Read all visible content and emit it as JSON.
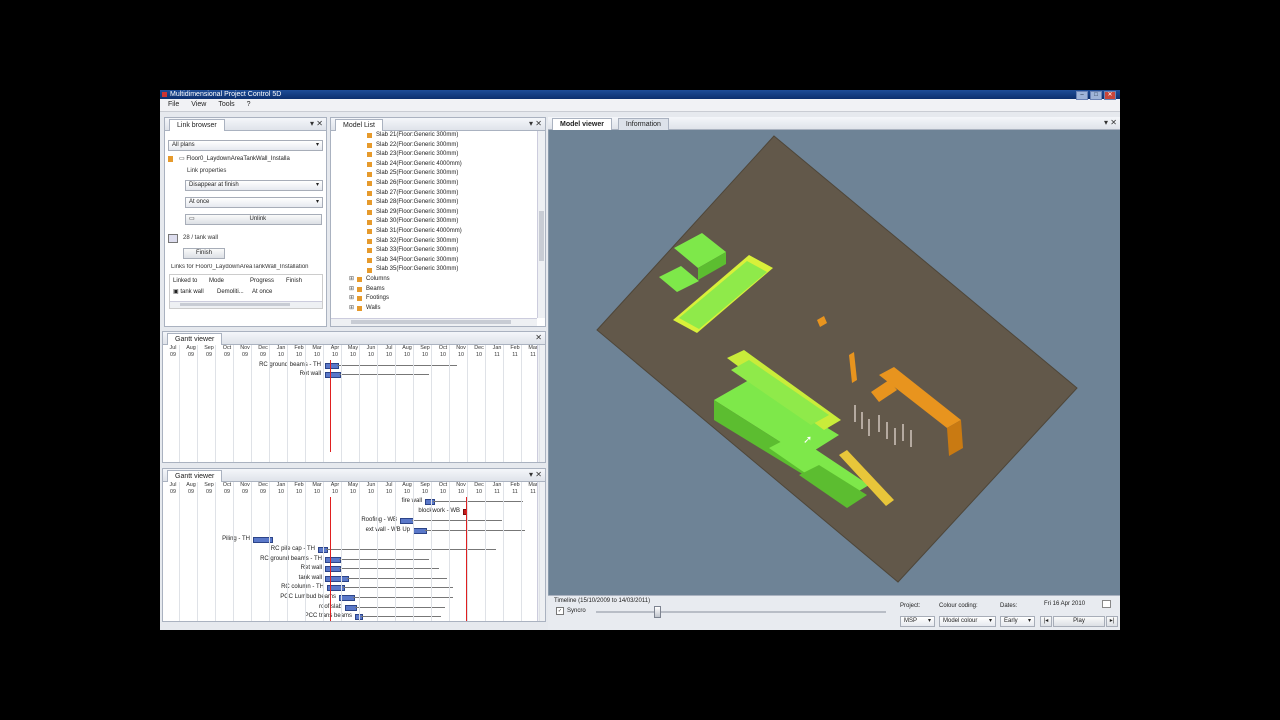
{
  "window": {
    "title": "Multidimensional Project Control 5D"
  },
  "menu": [
    "File",
    "View",
    "Tools",
    "?"
  ],
  "link_browser": {
    "tab": "Link browser",
    "plans": "All plans",
    "item": "Floor0_LaydownAreaTankWall_Installa",
    "link_properties": "Link properties",
    "mode": "Disappear at finish",
    "timing": "At once",
    "unlink": "Unlink",
    "task": "28 / tank wall",
    "finish": "Finish",
    "links_for": "Links for Floor0_LaydownAreaTankWall_Installation",
    "headers": [
      "Linked to",
      "Mode",
      "Progress",
      "Finish"
    ],
    "row": [
      "tank wall",
      "Demoliti...",
      "At once"
    ]
  },
  "model_list": {
    "tab": "Model List",
    "slabs": [
      "Slab 21(Floor:Generic 300mm)",
      "Slab 22(Floor:Generic 300mm)",
      "Slab 23(Floor:Generic 300mm)",
      "Slab 24(Floor:Generic 4000mm)",
      "Slab 25(Floor:Generic 300mm)",
      "Slab 26(Floor:Generic 300mm)",
      "Slab 27(Floor:Generic 300mm)",
      "Slab 28(Floor:Generic 300mm)",
      "Slab 29(Floor:Generic 300mm)",
      "Slab 30(Floor:Generic 300mm)",
      "Slab 31(Floor:Generic 4000mm)",
      "Slab 32(Floor:Generic 300mm)",
      "Slab 33(Floor:Generic 300mm)",
      "Slab 34(Floor:Generic 300mm)",
      "Slab 35(Floor:Generic 300mm)"
    ],
    "groups": [
      "Columns",
      "Beams",
      "Footings",
      "Walls"
    ]
  },
  "gantt1": {
    "tab": "Gantt viewer",
    "months": [
      "Jul",
      "Aug",
      "Sep",
      "Oct",
      "Nov",
      "Dec",
      "Jan",
      "Feb",
      "Mar",
      "Apr",
      "May",
      "Jun",
      "Jul",
      "Aug",
      "Sep",
      "Oct",
      "Nov",
      "Dec",
      "Jan",
      "Feb",
      "Mar"
    ],
    "years": [
      "09",
      "09",
      "09",
      "09",
      "09",
      "09",
      "10",
      "10",
      "10",
      "10",
      "10",
      "10",
      "10",
      "10",
      "10",
      "10",
      "10",
      "10",
      "11",
      "11",
      "11"
    ],
    "tasks": [
      "RC ground beams - TH",
      "Ret wall"
    ]
  },
  "gantt2": {
    "tab": "Gantt viewer",
    "tasks": [
      "fire wall",
      "blockwork - WB",
      "Roofing - WB",
      "ext wall - WB Up",
      "Piling - TH",
      "RC pile cap - TH",
      "RC ground beams - TH",
      "Ret wall",
      "tank wall",
      "RC column - TH",
      "PCC Lumbud beams",
      "roof slab",
      "PCC trans beams"
    ]
  },
  "viewer": {
    "tabs": [
      "Model viewer",
      "Information"
    ],
    "timeline": "Timeline (15/10/2009 to 14/03/2011)",
    "syncro": "Syncro",
    "project_label": "Project:",
    "project": "MSP",
    "colour_label": "Colour coding:",
    "colour": "Model colour",
    "dates_label": "Dates:",
    "dates": "Early",
    "date": "Fri 16 Apr 2010",
    "play": "Play",
    "slider_position": 0.2
  }
}
